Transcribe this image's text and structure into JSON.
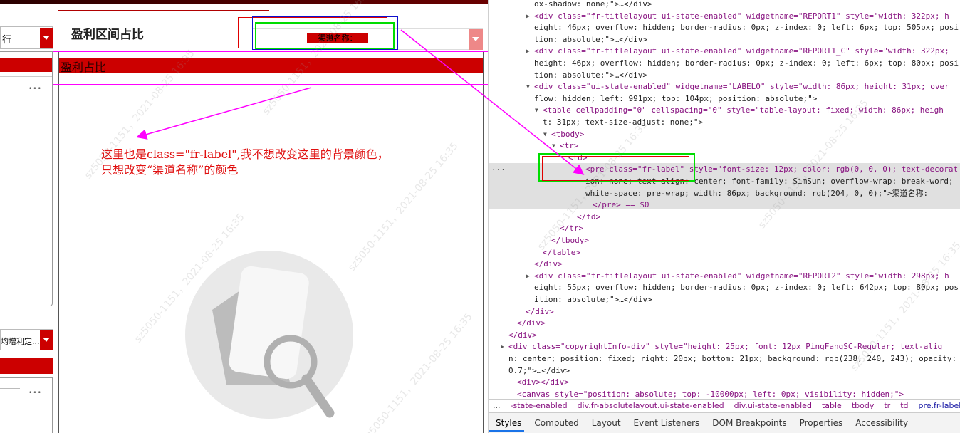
{
  "report": {
    "chart_title": "盈利区间占比",
    "channel_label": "渠道名称：",
    "bar_text": "盈利占比",
    "left_select_char": "行",
    "left_select_bottom": "均增利定...",
    "more_dots": "•••"
  },
  "annotation": {
    "line1": "这里也是class=\"fr-label\",我不想改变这里的背景颜色，",
    "line2": "只想改变“渠道名称”的颜色"
  },
  "watermark": "sz5050-1151，2021-08-25 16:35",
  "devtools": {
    "lines": [
      "ox-shadow: none;\">…</div>",
      "<div class=\"fr-titlelayout ui-state-enabled\" widgetname=\"REPORT1\" style=\"width: 322px; h",
      "eight: 46px; overflow: hidden; border-radius: 0px; z-index: 0; left: 6px; top: 505px; posi",
      "tion: absolute;\">…</div>",
      "<div class=\"fr-titlelayout ui-state-enabled\" widgetname=\"REPORT1_C\" style=\"width: 322px;",
      "height: 46px; overflow: hidden; border-radius: 0px; z-index: 0; left: 6px; top: 80px; posi",
      "tion: absolute;\">…</div>",
      "<div class=\"ui-state-enabled\" widgetname=\"LABEL0\" style=\"width: 86px; height: 31px; over",
      "flow: hidden; left: 991px; top: 104px; position: absolute;\">",
      "<table cellpadding=\"0\" cellspacing=\"0\" style=\"table-layout: fixed; width: 86px; heigh",
      "t: 31px; text-size-adjust: none;\">",
      "<tbody>",
      "<tr>",
      "<td>",
      "<pre class=\"fr-label\" style=\"font-size: 12px; color: rgb(0, 0, 0); text-decorat",
      "ion: none; text-align: center; font-family: SimSun; overflow-wrap: break-word;",
      "white-space: pre-wrap; width: 86px; background: rgb(204, 0, 0);\">渠道名称:",
      "</pre> == $0",
      "</td>",
      "</tr>",
      "</tbody>",
      "</table>",
      "</div>",
      "<div class=\"fr-titlelayout ui-state-enabled\" widgetname=\"REPORT2\" style=\"width: 298px; h",
      "eight: 55px; overflow: hidden; border-radius: 0px; z-index: 0; left: 642px; top: 80px; pos",
      "ition: absolute;\">…</div>",
      "</div>",
      "</div>",
      "</div>",
      "<div class=\"copyrightInfo-div\" style=\"height: 25px; font: 12px PingFangSC-Regular; text-alig",
      "n: center; position: fixed; right: 20px; bottom: 21px; background: rgb(238, 240, 243); opacity:",
      "0.7;\">…</div>",
      "<div></div>",
      "<canvas style=\"position: absolute; top: -10000px; left: 0px; visibility: hidden;\">"
    ],
    "breadcrumb": [
      "...",
      "-state-enabled",
      "div.fr-absolutelayout.ui-state-enabled",
      "div.ui-state-enabled",
      "table",
      "tbody",
      "tr",
      "td",
      "pre.fr-label"
    ],
    "tabs": [
      "Styles",
      "Computed",
      "Layout",
      "Event Listeners",
      "DOM Breakpoints",
      "Properties",
      "Accessibility"
    ],
    "gutter_dots": "..."
  },
  "colors": {
    "brand_red": "#cc0000",
    "annotation": "#ff00ff",
    "box_red": "#e00000",
    "box_green": "#00dd00",
    "box_blue": "#1010cc"
  }
}
